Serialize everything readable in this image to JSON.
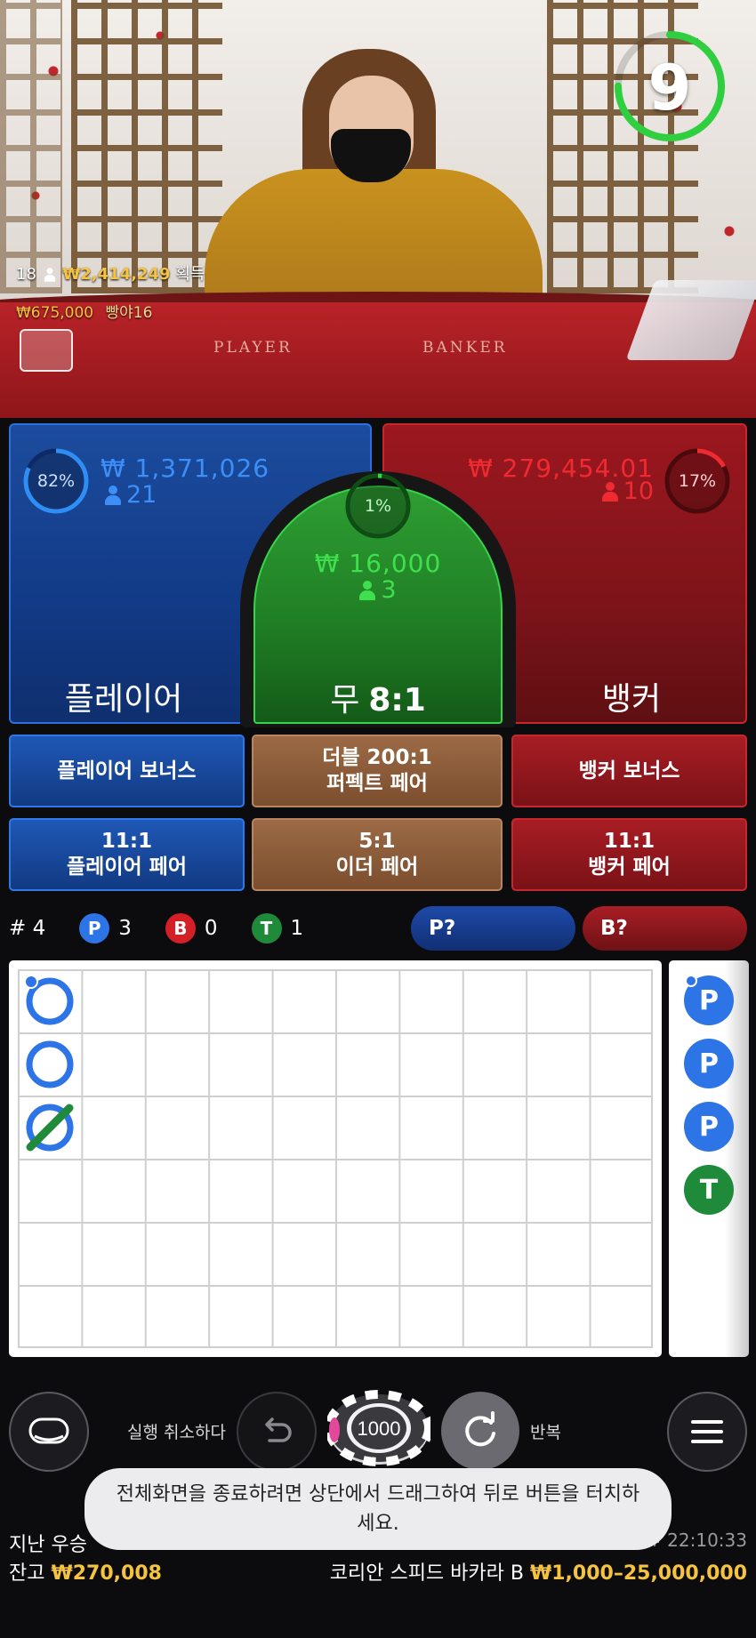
{
  "timer": {
    "value": "9",
    "progress": 0.75,
    "color": "#2fcf3f"
  },
  "last_win": {
    "rank": "18",
    "amount": "₩2,414,249",
    "label": "획득",
    "bet_amount": "₩675,000",
    "username": "빵야16"
  },
  "table_text": {
    "player": "PLAYER",
    "banker": "BANKER"
  },
  "player": {
    "percent": "82%",
    "percent_value": 0.82,
    "amount": "₩ 1,371,026",
    "count": "21",
    "label": "플레이어",
    "color": "#2d74e6"
  },
  "tie": {
    "percent": "1%",
    "percent_value": 0.01,
    "amount": "₩ 16,000",
    "count": "3",
    "label": "무",
    "odds": "8:1",
    "color": "#36d54a"
  },
  "banker": {
    "percent": "17%",
    "percent_value": 0.17,
    "amount": "₩ 279,454.01",
    "count": "10",
    "label": "뱅커",
    "color": "#e0242c"
  },
  "side_bets": {
    "player_bonus": "플레이어 보너스",
    "perfect_pair_line1": "더블 200:1",
    "perfect_pair_line2": "퍼펙트 페어",
    "banker_bonus": "뱅커 보너스",
    "player_pair_odds": "11:1",
    "player_pair": "플레이어 페어",
    "either_pair_odds": "5:1",
    "either_pair": "이더 페어",
    "banker_pair_odds": "11:1",
    "banker_pair": "뱅커 페어"
  },
  "stats": {
    "round": "# 4",
    "p_icon": "P",
    "p_count": "3",
    "b_icon": "B",
    "b_count": "0",
    "t_icon": "T",
    "t_count": "1"
  },
  "predict": {
    "player": "P?",
    "banker": "B?"
  },
  "bead_road": [
    "P",
    "P",
    "P",
    "T"
  ],
  "controls": {
    "undo_label": "실행 취소하다",
    "chip_value": "1000",
    "repeat_label": "반복"
  },
  "toast": "전체화면을 종료하려면 상단에서 드래그하여 뒤로 버튼을 터치하세요.",
  "footer": {
    "last_winner_label": "지난 우승",
    "balance_label": "잔고",
    "balance_value": "₩270,008",
    "game_name": "코리안 스피드 바카라 B",
    "limits": "₩1,000–25,000,000",
    "time": "# 22:10:33"
  }
}
